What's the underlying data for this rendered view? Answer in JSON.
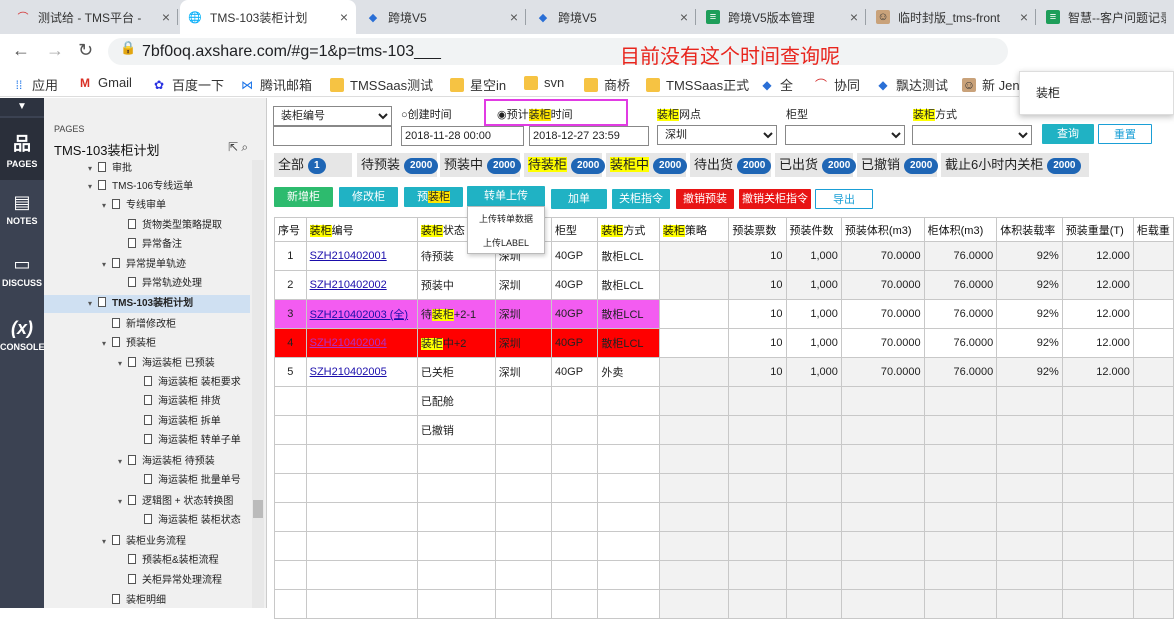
{
  "browser": {
    "tabs": [
      {
        "title": "测试给 - TMS平台 -",
        "icon": "tms-icon"
      },
      {
        "title": "TMS-103装柜计划",
        "icon": "globe-icon"
      },
      {
        "title": "跨境V5",
        "icon": "kj-icon"
      },
      {
        "title": "跨境V5",
        "icon": "kj-icon"
      },
      {
        "title": "跨境V5版本管理",
        "icon": "sheet-icon"
      },
      {
        "title": "临时封版_tms-front",
        "icon": "avatar-icon"
      },
      {
        "title": "智慧--客户问题记录",
        "icon": "sheet-icon"
      }
    ],
    "url": "7bf0oq.axshare.com/#g=1&p=tms-103___",
    "url_annotation": "目前没有这个时间查询呢",
    "bookmarks": [
      "应用",
      "Gmail",
      "百度一下",
      "腾讯邮箱",
      "TMSSaas测试",
      "星空in",
      "svn",
      "商桥",
      "TMSSaas正式",
      "全",
      "协同",
      "飘达测试",
      "新 Jen"
    ],
    "popup_text": "装柜"
  },
  "rail": {
    "items": [
      {
        "label": "PAGES",
        "icon": "sitemap-icon"
      },
      {
        "label": "NOTES",
        "icon": "notes-icon"
      },
      {
        "label": "DISCUSS",
        "icon": "comment-icon"
      },
      {
        "label": "CONSOLE",
        "icon": "function-icon"
      }
    ]
  },
  "pages_panel": {
    "section_label": "PAGES",
    "title": "TMS-103装柜计划",
    "tree": [
      {
        "label": "审批",
        "level": 2,
        "arrow": "▾"
      },
      {
        "label": "TMS-106专线运单",
        "level": 2,
        "arrow": "▾"
      },
      {
        "label": "专线审单",
        "level": 3,
        "arrow": "▾"
      },
      {
        "label": "货物类型策略提取",
        "level": 4,
        "arrow": ""
      },
      {
        "label": "异常备注",
        "level": 4,
        "arrow": ""
      },
      {
        "label": "异常提单轨迹",
        "level": 3,
        "arrow": "▾"
      },
      {
        "label": "异常轨迹处理",
        "level": 4,
        "arrow": ""
      },
      {
        "label": "TMS-103装柜计划",
        "level": 2,
        "arrow": "▾",
        "selected": true
      },
      {
        "label": "新增修改柜",
        "level": 3,
        "arrow": ""
      },
      {
        "label": "预装柜",
        "level": 3,
        "arrow": "▾"
      },
      {
        "label": "海运装柜 已预装",
        "level": 4,
        "arrow": "▾"
      },
      {
        "label": "海运装柜 装柜要求",
        "level": 5,
        "arrow": ""
      },
      {
        "label": "海运装柜 排货",
        "level": 5,
        "arrow": ""
      },
      {
        "label": "海运装柜 拆单",
        "level": 5,
        "arrow": ""
      },
      {
        "label": "海运装柜 转单子单",
        "level": 5,
        "arrow": ""
      },
      {
        "label": "海运装柜 待预装",
        "level": 4,
        "arrow": "▾"
      },
      {
        "label": "海运装柜 批量单号",
        "level": 5,
        "arrow": ""
      },
      {
        "label": "逻辑图 + 状态转换图",
        "level": 4,
        "arrow": "▾"
      },
      {
        "label": "海运装柜 装柜状态",
        "level": 5,
        "arrow": ""
      },
      {
        "label": "装柜业务流程",
        "level": 3,
        "arrow": "▾"
      },
      {
        "label": "预装柜&装柜流程",
        "level": 4,
        "arrow": ""
      },
      {
        "label": "关柜异常处理流程",
        "level": 4,
        "arrow": ""
      },
      {
        "label": "装柜明细",
        "level": 3,
        "arrow": ""
      }
    ]
  },
  "filters": {
    "field_select": "装柜编号",
    "radio_create": "创建时间",
    "radio_plan": "预计装柜时间",
    "date_from": "2018-11-28 00:00",
    "date_to": "2018-12-27 23:59",
    "network_label": "装柜网点",
    "network_value": "深圳",
    "cabinet_type_label": "柜型",
    "cabinet_type_value": "",
    "method_label": "装柜方式",
    "method_value": "",
    "query_button": "查询",
    "reset_button": "重置"
  },
  "status_tabs": [
    {
      "label": "全部",
      "count": "1"
    },
    {
      "label": "待预装",
      "count": "2000"
    },
    {
      "label": "预装中",
      "count": "2000"
    },
    {
      "label": "待装柜",
      "count": "2000"
    },
    {
      "label": "装柜中",
      "count": "2000"
    },
    {
      "label": "待出货",
      "count": "2000"
    },
    {
      "label": "已出货",
      "count": "2000"
    },
    {
      "label": "已撤销",
      "count": "2000"
    },
    {
      "label": "截止6小时内关柜",
      "count": "2000"
    }
  ],
  "actions": {
    "add": "新增柜",
    "edit": "修改柜",
    "preload": "预装柜",
    "transfer": "转单上传",
    "add_order": "加单",
    "close_cmd": "关柜指令",
    "cancel_preload": "撤销预装",
    "cancel_close": "撤销关柜指令",
    "export": "导出",
    "dropdown": [
      "上传转单数据",
      "上传LABEL"
    ]
  },
  "table": {
    "headers": [
      "序号",
      "装柜编号",
      "装柜状态",
      "",
      "柜型",
      "装柜方式",
      "装柜策略",
      "预装票数",
      "预装件数",
      "预装体积(m3)",
      "柜体积(m3)",
      "体积装载率",
      "预装重量(T)",
      "柜载重"
    ],
    "rows": [
      {
        "idx": "1",
        "code": "SZH210402001",
        "status": "待预装",
        "net": "深圳",
        "type": "40GP",
        "method": "散柜LCL",
        "strategy": "",
        "tickets": "10",
        "pieces": "1,000",
        "vol": "70.0000",
        "cvol": "76.0000",
        "rate": "92%",
        "weight": "12.000"
      },
      {
        "idx": "2",
        "code": "SZH210402002",
        "status": "预装中",
        "net": "深圳",
        "type": "40GP",
        "method": "散柜LCL",
        "strategy": "",
        "tickets": "10",
        "pieces": "1,000",
        "vol": "70.0000",
        "cvol": "76.0000",
        "rate": "92%",
        "weight": "12.000"
      },
      {
        "idx": "3",
        "code": "SZH210402003 (全)",
        "status": "待装柜+2-1",
        "net": "深圳",
        "type": "40GP",
        "method": "散柜LCL",
        "strategy": "",
        "tickets": "10",
        "pieces": "1,000",
        "vol": "70.0000",
        "cvol": "76.0000",
        "rate": "92%",
        "weight": "12.000"
      },
      {
        "idx": "4",
        "code": "SZH210402004",
        "status": "装柜中+2",
        "net": "深圳",
        "type": "40GP",
        "method": "散柜LCL",
        "strategy": "",
        "tickets": "10",
        "pieces": "1,000",
        "vol": "70.0000",
        "cvol": "76.0000",
        "rate": "92%",
        "weight": "12.000"
      },
      {
        "idx": "5",
        "code": "SZH210402005",
        "status": "已关柜",
        "net": "深圳",
        "type": "40GP",
        "method": "外卖",
        "strategy": "",
        "tickets": "10",
        "pieces": "1,000",
        "vol": "70.0000",
        "cvol": "76.0000",
        "rate": "92%",
        "weight": "12.000"
      },
      {
        "idx": "",
        "code": "",
        "status": "已配舱",
        "net": "",
        "type": "",
        "method": "",
        "strategy": "",
        "tickets": "",
        "pieces": "",
        "vol": "",
        "cvol": "",
        "rate": "",
        "weight": ""
      },
      {
        "idx": "",
        "code": "",
        "status": "已撤销",
        "net": "",
        "type": "",
        "method": "",
        "strategy": "",
        "tickets": "",
        "pieces": "",
        "vol": "",
        "cvol": "",
        "rate": "",
        "weight": ""
      }
    ]
  },
  "colors": {
    "highlight": "#ffff00",
    "pink_row": "#f35cf1",
    "red_row": "#ff0000",
    "accent": "#20b2c4",
    "badge": "#1f66b5"
  }
}
